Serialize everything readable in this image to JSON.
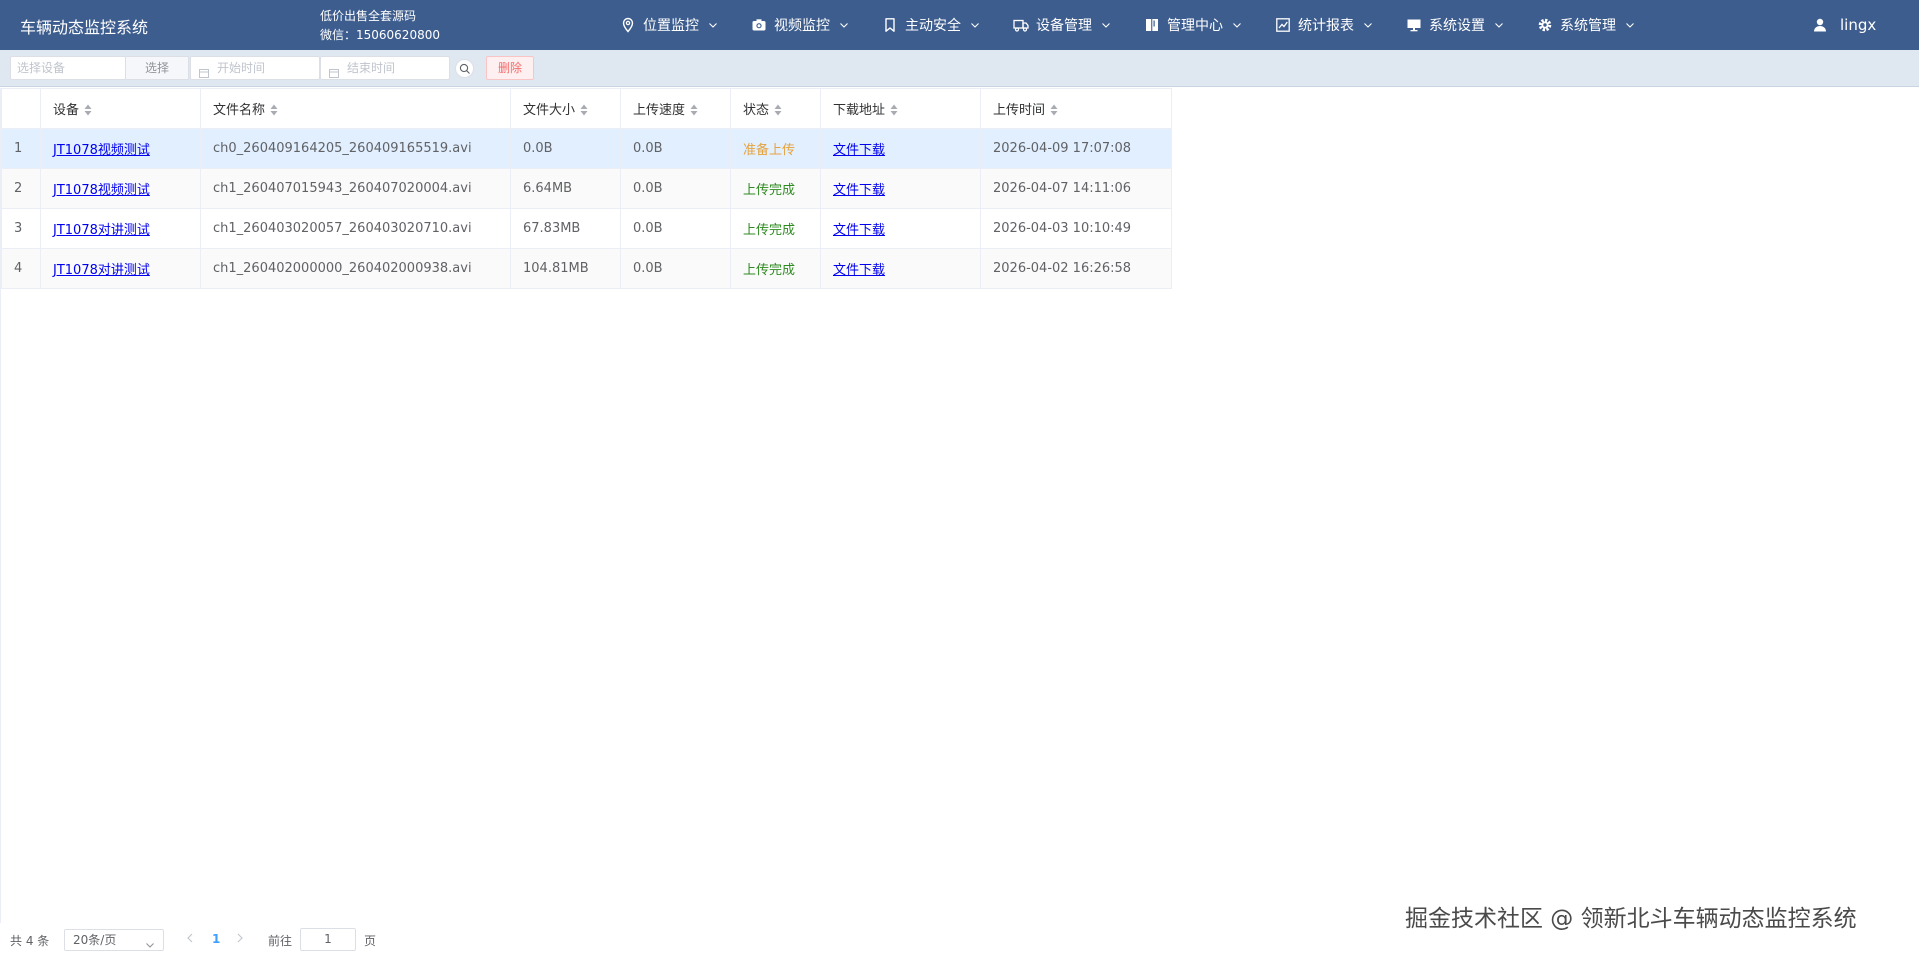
{
  "header": {
    "app_title": "车辆动态监控系统",
    "promo_line1": "低价出售全套源码",
    "promo_line2": "微信：15060620800",
    "nav": [
      {
        "label": "位置监控",
        "icon": "location-pin-icon"
      },
      {
        "label": "视频监控",
        "icon": "camera-icon"
      },
      {
        "label": "主动安全",
        "icon": "bookmark-icon"
      },
      {
        "label": "设备管理",
        "icon": "truck-icon"
      },
      {
        "label": "管理中心",
        "icon": "book-icon"
      },
      {
        "label": "统计报表",
        "icon": "chart-icon"
      },
      {
        "label": "系统设置",
        "icon": "monitor-icon"
      },
      {
        "label": "系统管理",
        "icon": "gear-icon"
      }
    ],
    "user": {
      "name": "lingx",
      "icon": "user-icon"
    }
  },
  "toolbar": {
    "device_placeholder": "选择设备",
    "select_label": "选择",
    "start_placeholder": "开始时间",
    "end_placeholder": "结束时间",
    "delete_label": "删除"
  },
  "table": {
    "columns": [
      "设备",
      "文件名称",
      "文件大小",
      "上传速度",
      "状态",
      "下载地址",
      "上传时间"
    ],
    "rows": [
      {
        "idx": "1",
        "device": "JT1078视频测试",
        "file": "ch0_260409164205_260409165519.avi",
        "size": "0.0B",
        "speed": "0.0B",
        "status": "准备上传",
        "status_kind": "pending",
        "download": "文件下载",
        "time": "2026-04-09 17:07:08"
      },
      {
        "idx": "2",
        "device": "JT1078视频测试",
        "file": "ch1_260407015943_260407020004.avi",
        "size": "6.64MB",
        "speed": "0.0B",
        "status": "上传完成",
        "status_kind": "done",
        "download": "文件下载",
        "time": "2026-04-07 14:11:06"
      },
      {
        "idx": "3",
        "device": "JT1078对讲测试",
        "file": "ch1_260403020057_260403020710.avi",
        "size": "67.83MB",
        "speed": "0.0B",
        "status": "上传完成",
        "status_kind": "done",
        "download": "文件下载",
        "time": "2026-04-03 10:10:49"
      },
      {
        "idx": "4",
        "device": "JT1078对讲测试",
        "file": "ch1_260402000000_260402000938.avi",
        "size": "104.81MB",
        "speed": "0.0B",
        "status": "上传完成",
        "status_kind": "done",
        "download": "文件下载",
        "time": "2026-04-02 16:26:58"
      }
    ]
  },
  "pager": {
    "total": "共 4 条",
    "page_size": "20条/页",
    "current_page": "1",
    "goto_label": "前往",
    "goto_value": "1",
    "page_suffix": "页"
  },
  "watermark": "掘金技术社区 @ 领新北斗车辆动态监控系统",
  "colors": {
    "header_bg": "#3d5d8e",
    "toolbar_bg": "#dfe7f1",
    "link": "#0000ee",
    "status_pending": "#e6a23c",
    "status_done": "#2e8b20",
    "delete": "#f56c6c",
    "selected_row": "#e1efff"
  }
}
